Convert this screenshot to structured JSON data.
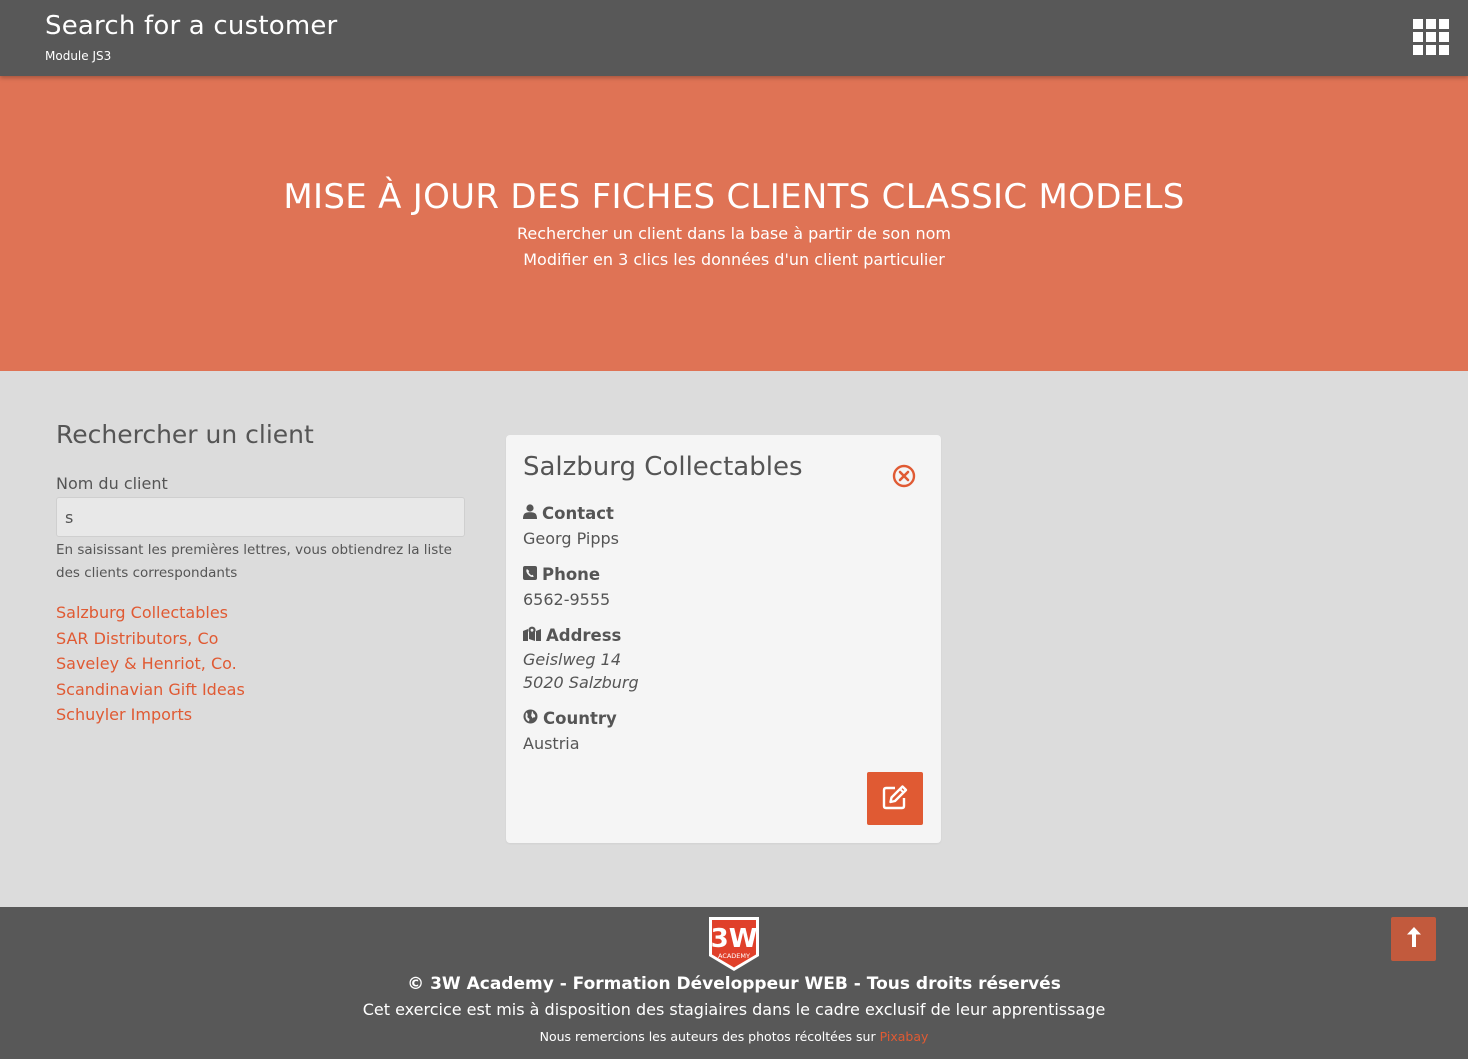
{
  "header": {
    "title": "Search for a customer",
    "subtitle": "Module JS3",
    "menu_icon": "grid-icon"
  },
  "hero": {
    "title": "MISE À JOUR DES FICHES CLIENTS CLASSIC MODELS",
    "line1": "Rechercher un client dans la base à partir de son nom",
    "line2": "Modifier en 3 clics les données d'un client particulier"
  },
  "search": {
    "title": "Rechercher un client",
    "field_label": "Nom du client",
    "value": "s",
    "help": "En saisissant les premières lettres, vous obtiendrez la liste des clients correspondants",
    "results": [
      "Salzburg Collectables",
      "SAR Distributors, Co",
      "Saveley & Henriot, Co.",
      "Scandinavian Gift Ideas",
      "Schuyler Imports"
    ]
  },
  "card": {
    "name": "Salzburg Collectables",
    "contact_label": "Contact",
    "contact_value": "Georg Pipps",
    "phone_label": "Phone",
    "phone_value": "6562-9555",
    "address_label": "Address",
    "address_line1": "Geislweg 14",
    "address_line2": "5020 Salzburg",
    "country_label": "Country",
    "country_value": "Austria"
  },
  "footer": {
    "logo_text": "3W",
    "logo_sub": "ACADEMY",
    "copyright": "© 3W Academy - Formation Développeur WEB - Tous droits réservés",
    "notice": "Cet exercice est mis à disposition des stagiaires dans le cadre exclusif de leur apprentissage",
    "thanks": "Nous remercions les auteurs des photos récoltées sur ",
    "thanks_link": "Pixabay"
  },
  "colors": {
    "accent": "#e05a33",
    "hero": "#df7355",
    "bar": "#585858",
    "background": "#dcdcdc",
    "card": "#f5f5f5"
  }
}
